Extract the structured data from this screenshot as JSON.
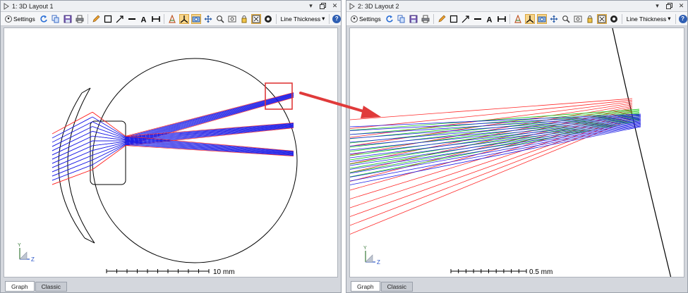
{
  "windows": [
    {
      "title": "1: 3D Layout 1",
      "toolbar": {
        "settings_label": "Settings",
        "dropdown_label": "Line Thickness"
      },
      "tabs": [
        "Graph",
        "Classic"
      ],
      "scale_label": "10 mm",
      "axis_labels": {
        "y": "Y",
        "z": "Z"
      }
    },
    {
      "title": "2: 3D Layout 2",
      "toolbar": {
        "settings_label": "Settings",
        "dropdown_label": "Line Thickness"
      },
      "tabs": [
        "Graph",
        "Classic"
      ],
      "scale_label": "0.5 mm",
      "axis_labels": {
        "y": "Y",
        "z": "Z"
      }
    }
  ],
  "colors": {
    "ray_blue": "#1e1ee6",
    "ray_red": "#ff2a2a",
    "ray_green": "#18c818",
    "highlight_box": "#e03a3a",
    "arrow": "#e03a3a",
    "active_tool": "#f7d58a",
    "help_icon": "#2f5fb3"
  },
  "icons": {
    "toolbar": [
      "refresh-icon",
      "copy-icon",
      "save-icon",
      "print-icon",
      "pencil-icon",
      "rectangle-icon",
      "arrow-line-icon",
      "line-icon",
      "text-icon",
      "dimension-icon",
      "color-icon",
      "axes-icon",
      "camera-icon",
      "pan-icon",
      "zoom-icon",
      "zoom-window-icon",
      "lock-icon",
      "fit-icon",
      "fullscreen-icon",
      "help-icon"
    ]
  }
}
